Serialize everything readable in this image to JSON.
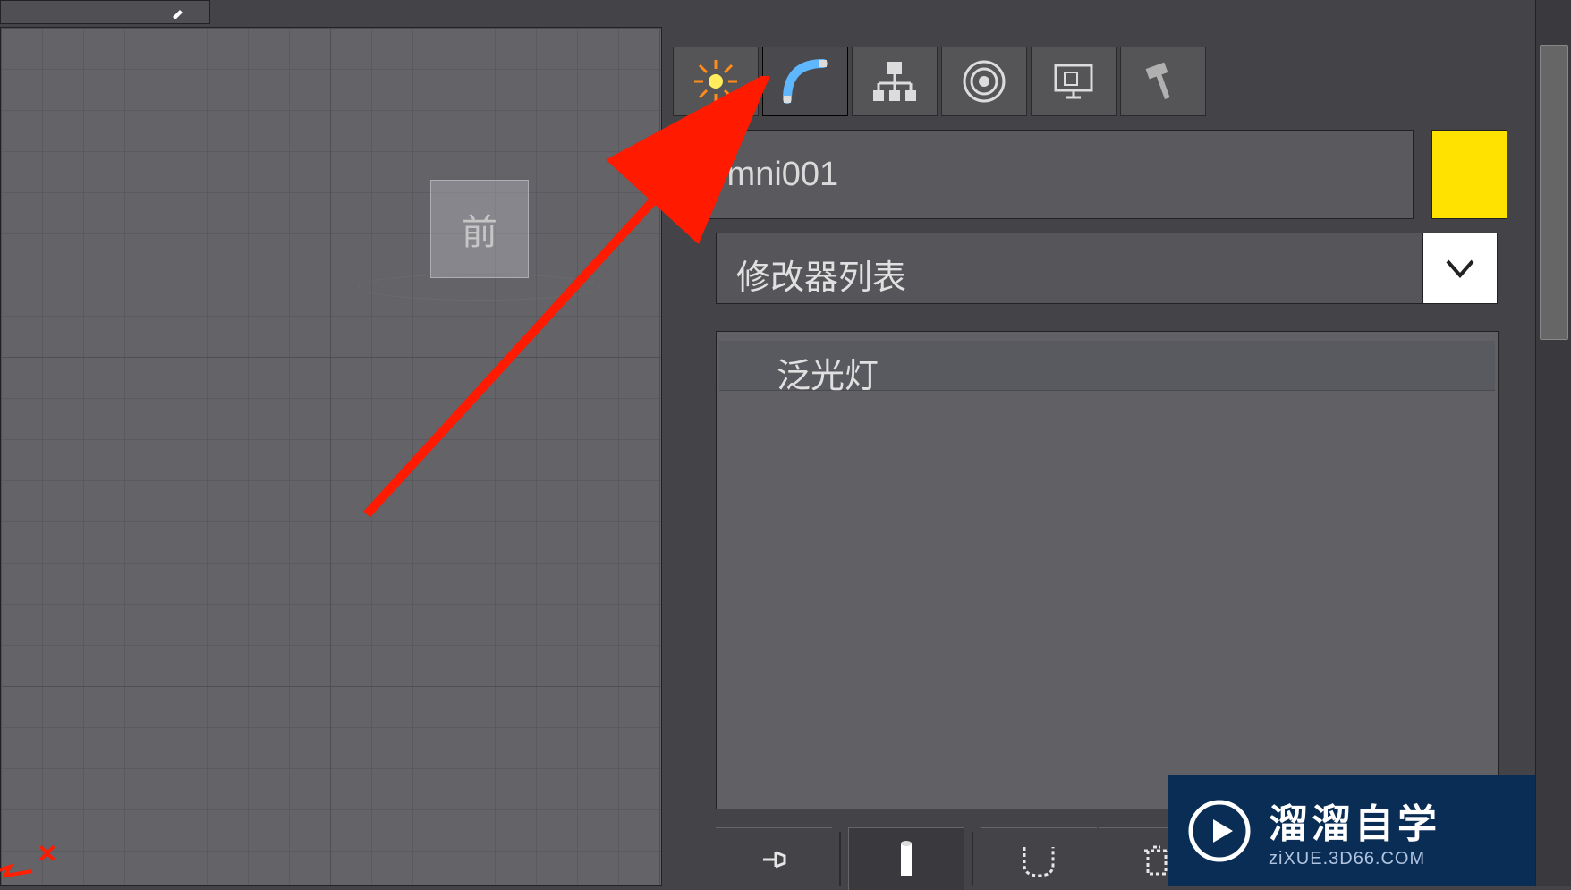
{
  "viewport": {
    "object_label": "前"
  },
  "panel": {
    "tabs": [
      {
        "name": "create"
      },
      {
        "name": "modify"
      },
      {
        "name": "hierarchy"
      },
      {
        "name": "motion"
      },
      {
        "name": "display"
      },
      {
        "name": "utilities"
      }
    ],
    "object_name": "Omni001",
    "color_swatch": "#ffe200",
    "modifier_dropdown_label": "修改器列表",
    "stack_item": "泛光灯"
  },
  "watermark": {
    "title": "溜溜自学",
    "subtitle": "ziXUE.3D66.COM"
  }
}
